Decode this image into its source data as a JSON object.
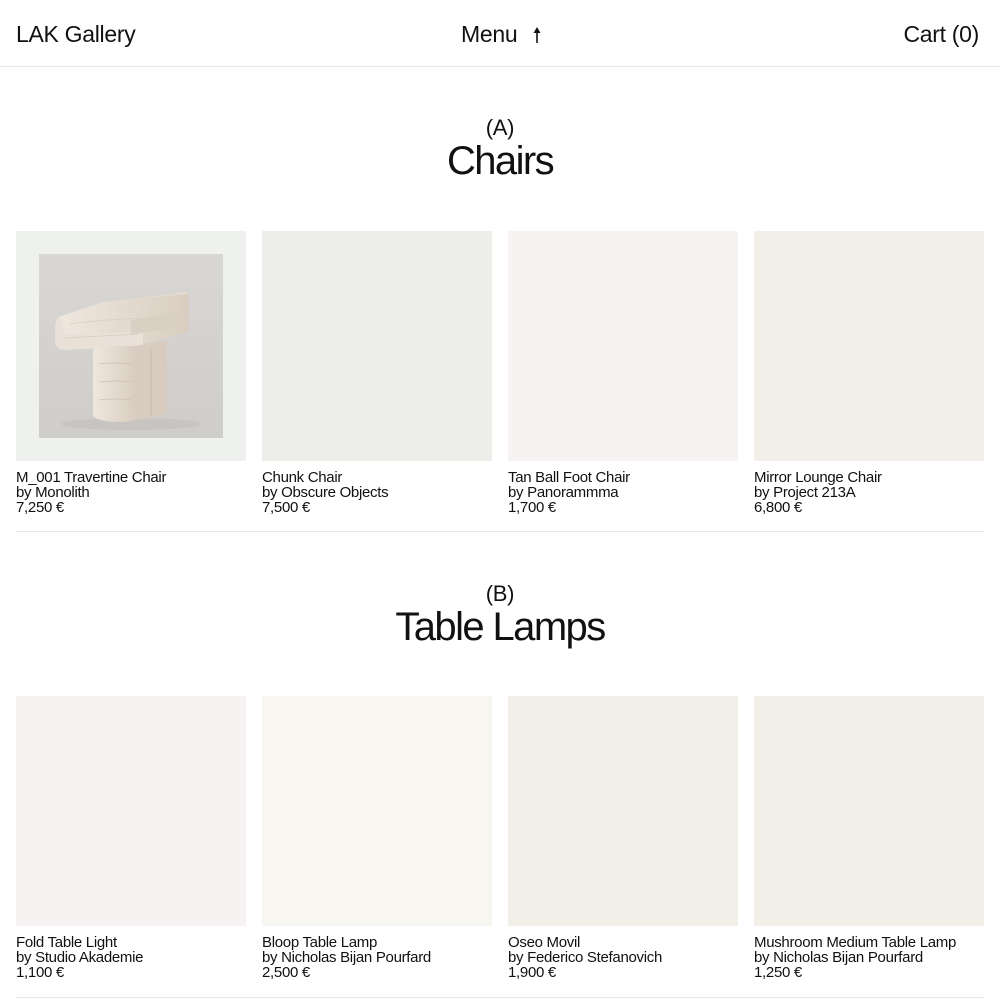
{
  "header": {
    "brand": "LAK Gallery",
    "menu_label": "Menu",
    "cart_label": "Cart (0)"
  },
  "sections": [
    {
      "letter": "(A)",
      "title": "Chairs",
      "products": [
        {
          "name": "M_001 Travertine Chair",
          "maker": "by Monolith",
          "price": "7,250 €",
          "tile_color": "#eff1ef"
        },
        {
          "name": "Chunk Chair",
          "maker": "by Obscure Objects",
          "price": "7,500 €",
          "tile_color": "#edeee9"
        },
        {
          "name": "Tan Ball Foot Chair",
          "maker": "by Panorammma",
          "price": "1,700 €",
          "tile_color": "#f6f3f2"
        },
        {
          "name": "Mirror Lounge Chair",
          "maker": "by Project 213A",
          "price": "6,800 €",
          "tile_color": "#f2efe9"
        }
      ]
    },
    {
      "letter": "(B)",
      "title": "Table Lamps",
      "products": [
        {
          "name": "Fold Table Light",
          "maker": "by Studio Akademie",
          "price": "1,100 €",
          "tile_color": "#f6f3f2"
        },
        {
          "name": "Bloop Table Lamp",
          "maker": "by Nicholas Bijan Pourfard",
          "price": "2,500 €",
          "tile_color": "#f8f6f0"
        },
        {
          "name": "Oseo Movil",
          "maker": "by Federico Stefanovich",
          "price": "1,900 €",
          "tile_color": "#f2eee8"
        },
        {
          "name": "Mushroom Medium Table Lamp",
          "maker": "by Nicholas Bijan Pourfard",
          "price": "1,250 €",
          "tile_color": "#f2efe9"
        }
      ]
    }
  ],
  "icons": {
    "menu_arrow": "arrow-up-icon"
  }
}
